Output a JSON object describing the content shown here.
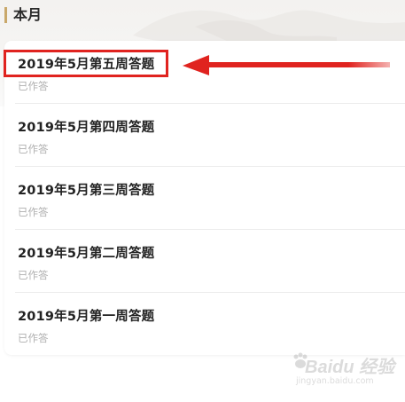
{
  "section": {
    "title": "本月"
  },
  "quiz_list": [
    {
      "title": "2019年5月第五周答题",
      "status": "已作答"
    },
    {
      "title": "2019年5月第四周答题",
      "status": "已作答"
    },
    {
      "title": "2019年5月第三周答题",
      "status": "已作答"
    },
    {
      "title": "2019年5月第二周答题",
      "status": "已作答"
    },
    {
      "title": "2019年5月第一周答题",
      "status": "已作答"
    }
  ],
  "annotation": {
    "color": "#e0231f"
  },
  "watermark": {
    "text": "Baidu 经验",
    "url": "jingyan.baidu.com"
  },
  "colors": {
    "accent": "#c9a86a",
    "title_text": "#222222",
    "status_text": "#b0b0b0"
  }
}
